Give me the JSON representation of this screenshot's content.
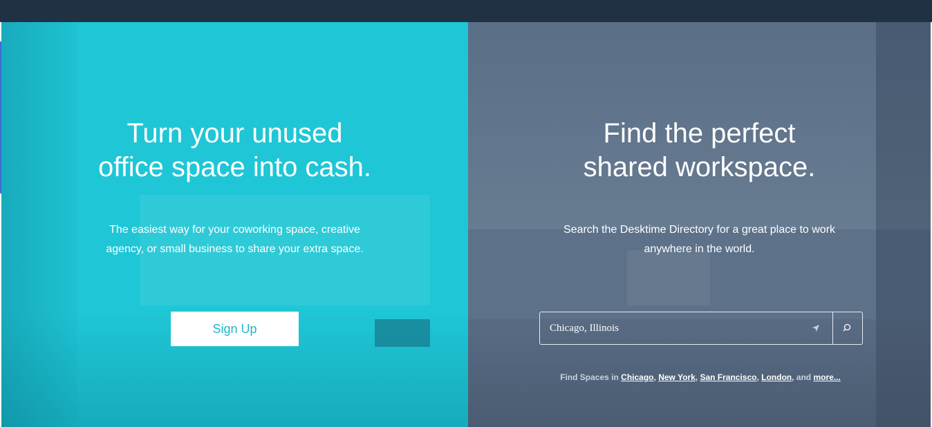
{
  "colors": {
    "topbar": "#203143",
    "left_panel": "#1fc6d6",
    "right_panel": "#5d7189",
    "signup_text": "#20b7c8"
  },
  "left": {
    "headline_line1": "Turn your unused",
    "headline_line2": "office space into cash.",
    "subtext_line1": "The easiest way for your coworking space, creative",
    "subtext_line2": "agency, or small business to share your extra space.",
    "signup_label": "Sign Up"
  },
  "right": {
    "headline_line1": "Find the perfect",
    "headline_line2": "shared workspace.",
    "subtext_line1": "Search the Desktime Directory for a great place to work",
    "subtext_line2": "anywhere in the world.",
    "search": {
      "value": "Chicago, Illinois",
      "locate_icon": "location-arrow-icon",
      "search_icon": "search-icon"
    },
    "find_spaces": {
      "prefix": "Find Spaces in",
      "cities": [
        "Chicago",
        "New York",
        "San Francisco",
        "London"
      ],
      "and": "and",
      "more": "more..."
    }
  }
}
